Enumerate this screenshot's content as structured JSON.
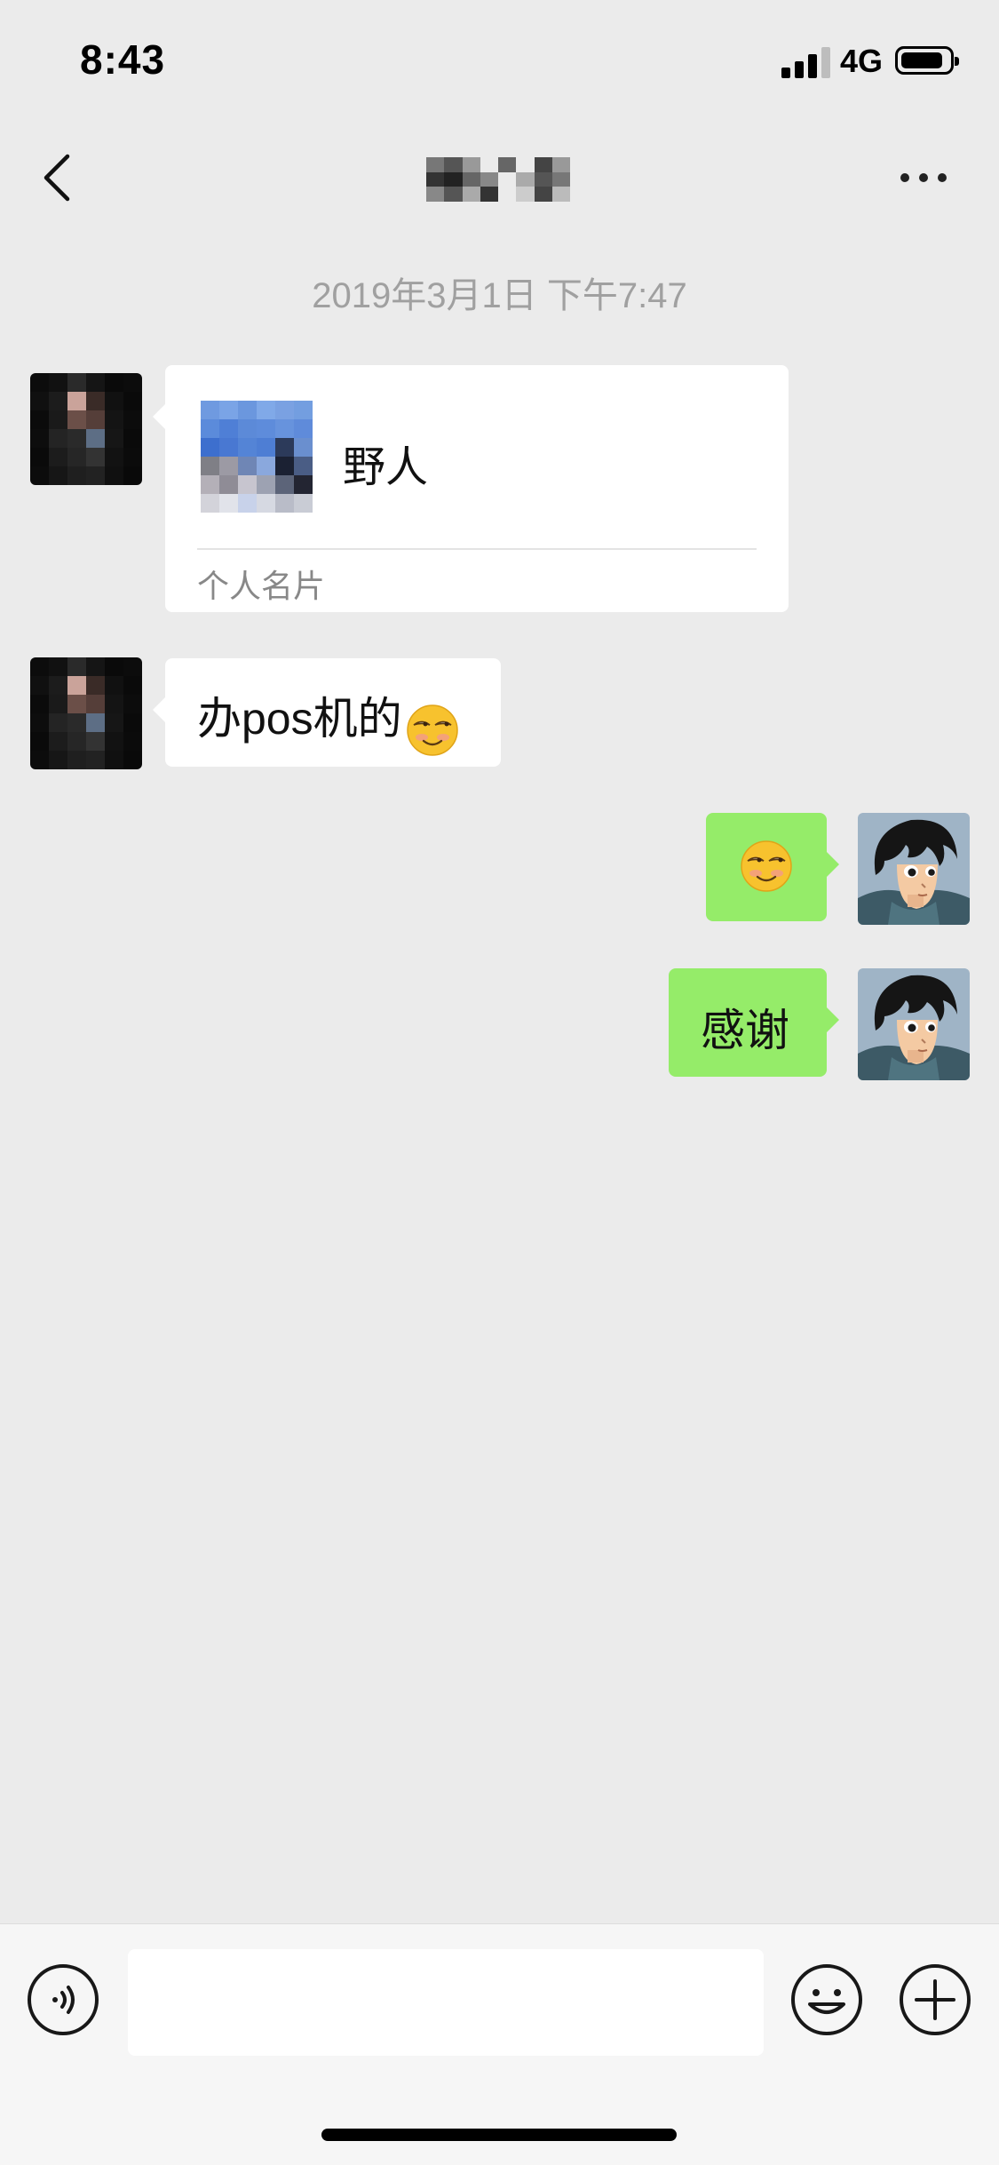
{
  "status_bar": {
    "time": "8:43",
    "network": "4G",
    "battery_level": 0.8
  },
  "nav": {
    "back_icon": "chevron-left-icon",
    "more_icon": "more-dots-icon",
    "title_redacted": true
  },
  "chat": {
    "timestamp": "2019年3月1日 下午7:47",
    "messages": [
      {
        "direction": "in",
        "kind": "contact-card",
        "card_name": "野人",
        "card_type": "个人名片",
        "avatar": "pixelated-avatar"
      },
      {
        "direction": "in",
        "kind": "text",
        "text": "办pos机的",
        "emoji": "smirk-emoji",
        "avatar": "pixelated-avatar"
      },
      {
        "direction": "out",
        "kind": "emoji",
        "emoji": "smirk-emoji",
        "avatar": "anime-boy-avatar"
      },
      {
        "direction": "out",
        "kind": "text",
        "text": "感谢",
        "avatar": "anime-boy-avatar"
      }
    ]
  },
  "input_bar": {
    "voice_icon": "voice-icon",
    "emoji_icon": "emoji-face-icon",
    "plus_icon": "plus-circle-icon",
    "input_value": "",
    "input_placeholder": ""
  },
  "colors": {
    "background": "#ebebeb",
    "incoming_bubble": "#ffffff",
    "outgoing_bubble": "#95ec69",
    "timestamp": "#a0a0a0"
  }
}
